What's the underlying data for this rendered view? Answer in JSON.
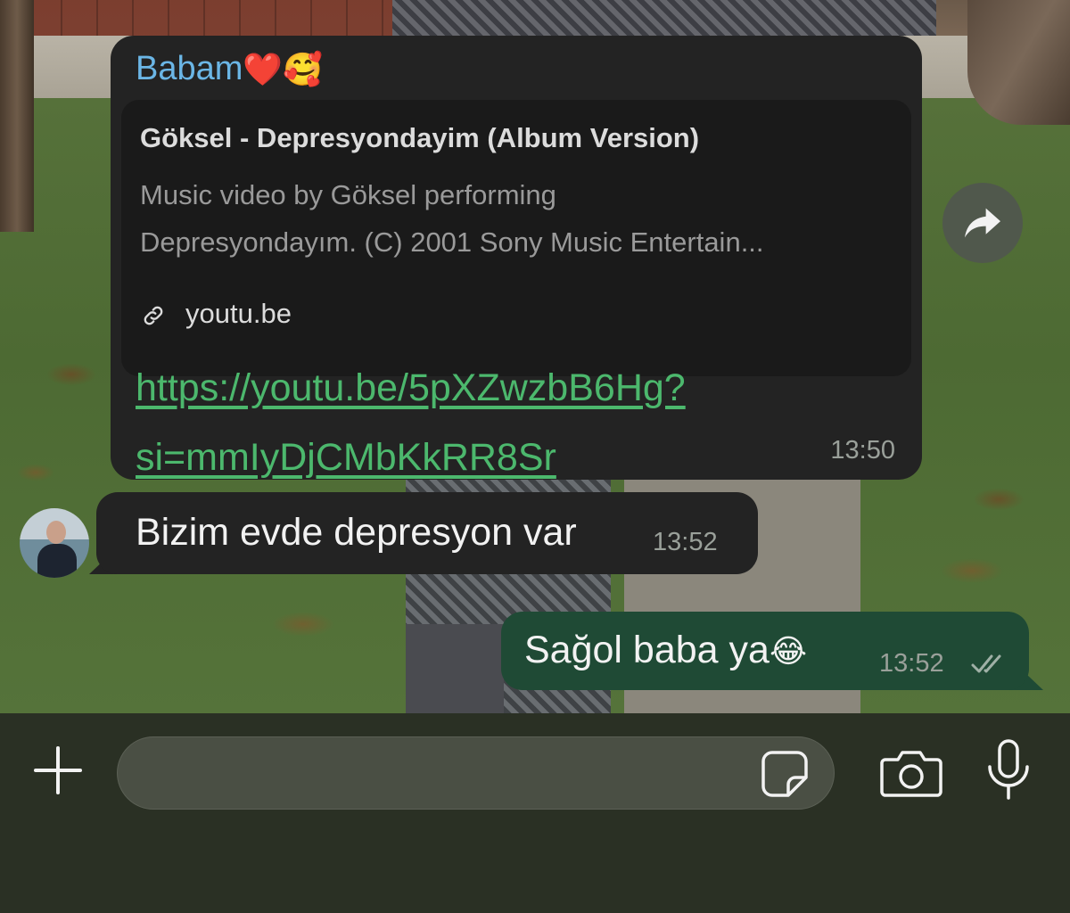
{
  "chat": {
    "link_message": {
      "sender": "Babam",
      "sender_emoji": "❤️🥰",
      "preview_title": "Göksel - Depresyondayim (Album Version)",
      "preview_desc_line1": "Music video by Göksel performing",
      "preview_desc_line2": "Depresyondayım. (C) 2001 Sony Music Entertain...",
      "preview_domain": "youtu.be",
      "url_line1": "https://youtu.be/5pXZwzbB6Hg?",
      "url_line2": "si=mmIyDjCMbKkRR8Sr",
      "time": "13:50"
    },
    "incoming_message": {
      "text": "Bizim evde depresyon var",
      "time": "13:52"
    },
    "outgoing_message": {
      "text": "Sağol baba ya",
      "emoji": "😂",
      "time": "13:52",
      "status": "read"
    }
  },
  "composer": {
    "placeholder": ""
  },
  "colors": {
    "incoming_bubble": "#232323",
    "outgoing_bubble": "#1f4a35",
    "sender_name": "#6bb6e6",
    "link": "#4cb86d",
    "composer_bg": "#2a3024"
  },
  "icons": [
    "link-icon",
    "forward-icon",
    "plus-icon",
    "sticker-icon",
    "camera-icon",
    "microphone-icon",
    "double-check-icon"
  ]
}
